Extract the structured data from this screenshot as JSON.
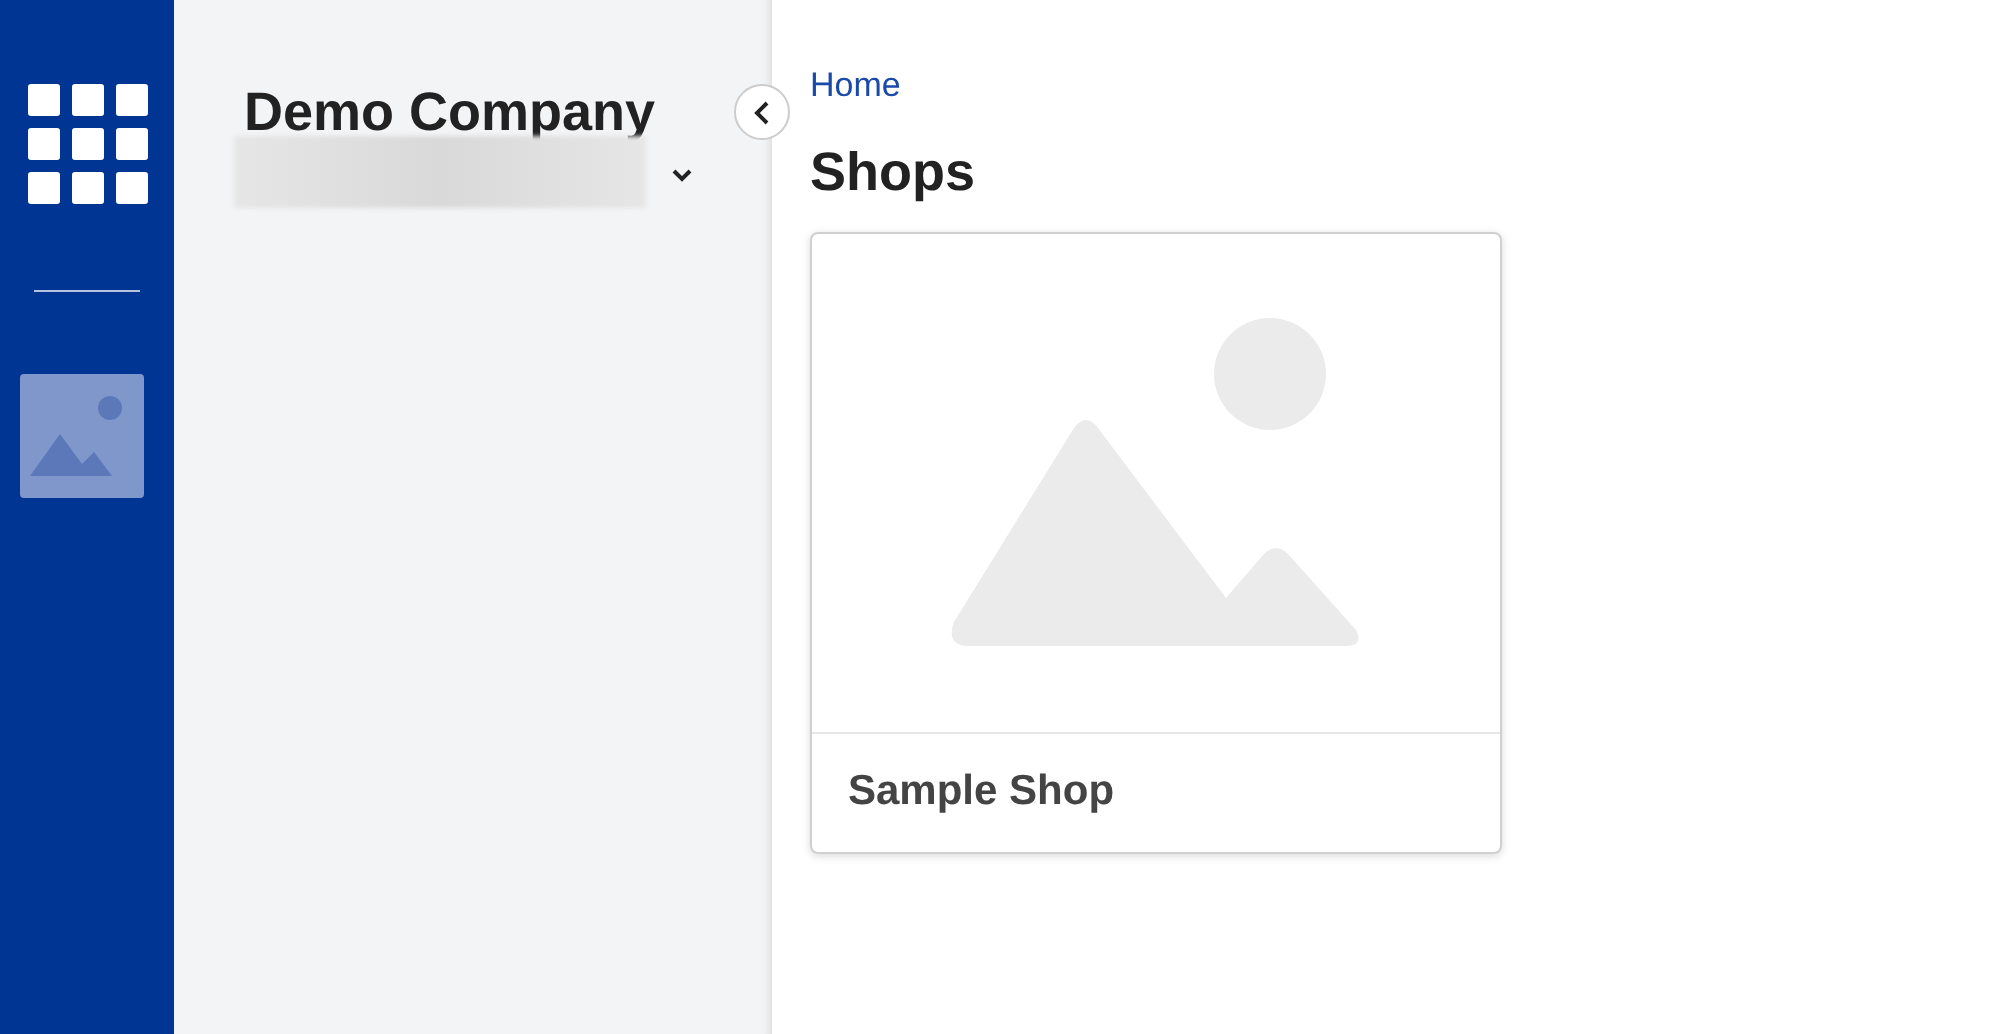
{
  "company": {
    "name": "Demo Company"
  },
  "breadcrumb": [
    "Home"
  ],
  "page_title": "Shops",
  "shops": [
    {
      "name": "Sample Shop"
    }
  ]
}
